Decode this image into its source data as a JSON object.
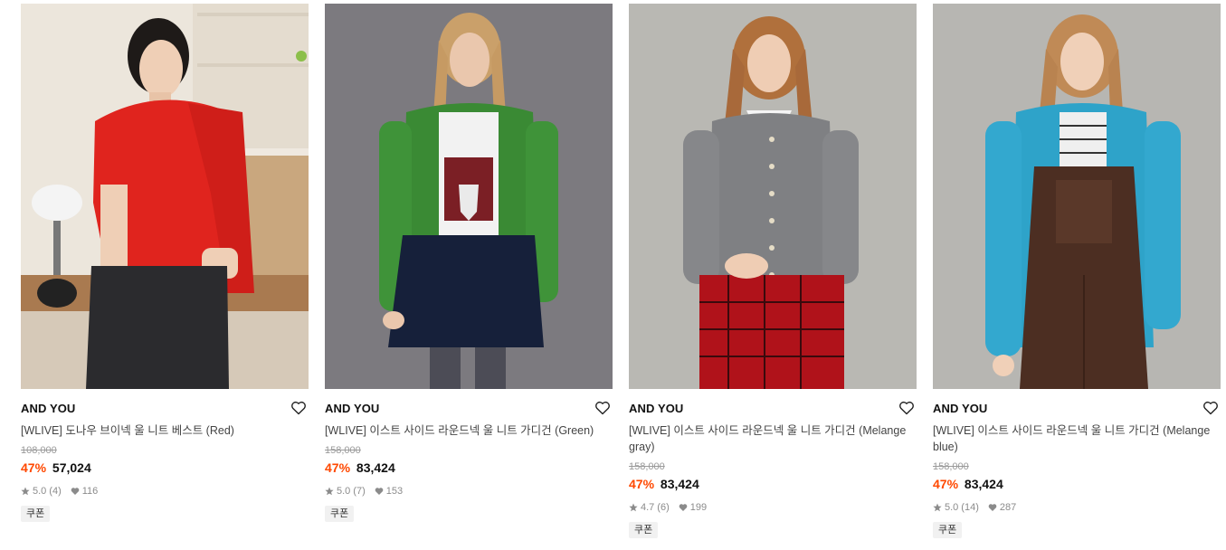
{
  "products": [
    {
      "brand": "AND YOU",
      "title": "[WLIVE] 도나우 브이넥 울 니트 베스트 (Red)",
      "original_price": "108,000",
      "discount": "47%",
      "price": "57,024",
      "rating": "5.0",
      "reviews": "(4)",
      "likes": "116",
      "badge": "쿠폰",
      "image_alt": "Woman wearing a red v-neck knit vest with sweater tied over shoulders and black jeans"
    },
    {
      "brand": "AND YOU",
      "title": "[WLIVE] 이스트 사이드 라운드넥 울 니트 가디건 (Green)",
      "original_price": "158,000",
      "discount": "47%",
      "price": "83,424",
      "rating": "5.0",
      "reviews": "(7)",
      "likes": "153",
      "badge": "쿠폰",
      "image_alt": "Woman wearing a green round-neck cardigan over a graphic tee and navy skirt"
    },
    {
      "brand": "AND YOU",
      "title": "[WLIVE] 이스트 사이드 라운드넥 울 니트 가디건 (Melange gray)",
      "original_price": "158,000",
      "discount": "47%",
      "price": "83,424",
      "rating": "4.7",
      "reviews": "(6)",
      "likes": "199",
      "badge": "쿠폰",
      "image_alt": "Woman wearing a melange gray cardigan with a red plaid skirt"
    },
    {
      "brand": "AND YOU",
      "title": "[WLIVE] 이스트 사이드 라운드넥 울 니트 가디건 (Melange blue)",
      "original_price": "158,000",
      "discount": "47%",
      "price": "83,424",
      "rating": "5.0",
      "reviews": "(14)",
      "likes": "287",
      "badge": "쿠폰",
      "image_alt": "Woman wearing a melange blue cardigan over a striped top and brown corduroy overalls"
    }
  ],
  "colors": {
    "discount": "#ff4800",
    "muted": "#8b8b8b",
    "badge_bg": "#f1f1f1"
  }
}
